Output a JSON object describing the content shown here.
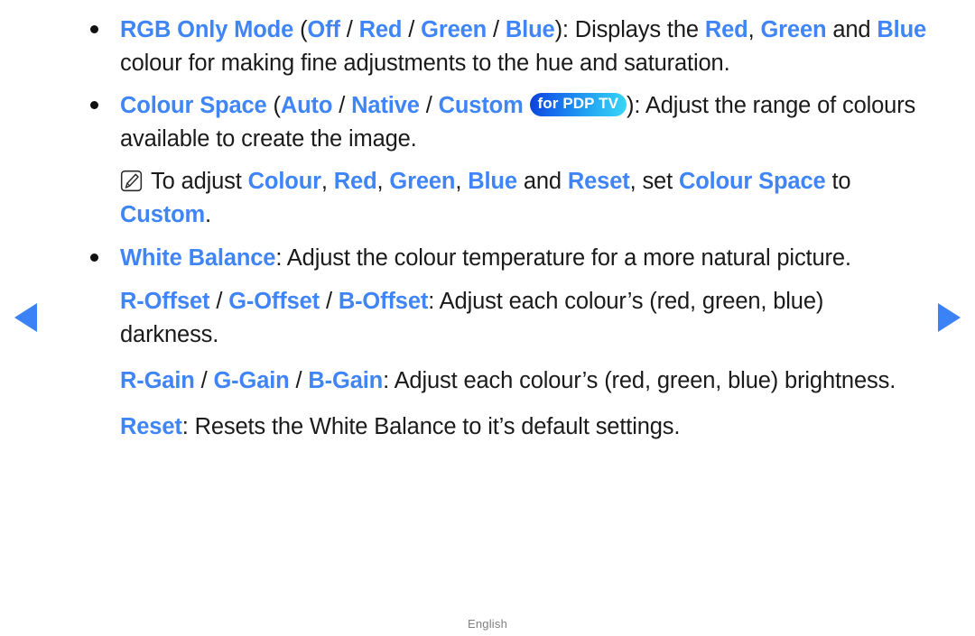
{
  "page": {
    "language_footer": "English",
    "accent_blue": "#3f85f7",
    "arrow_blue": "#3b82f6",
    "text_black": "#1a1a1a"
  },
  "nav": {
    "prev_icon": "triangle-left-icon",
    "next_icon": "triangle-right-icon"
  },
  "badge": {
    "for_pdp_tv": "for PDP TV",
    "gradient_from": "#0b3fd6",
    "gradient_to": "#3ad8f7"
  },
  "note_icon_name": "samsung-note-icon",
  "items": [
    {
      "type": "bullet",
      "runs": [
        {
          "t": "RGB Only Mode",
          "s": "kw"
        },
        {
          "t": " (",
          "s": "txt"
        },
        {
          "t": "Off",
          "s": "kw"
        },
        {
          "t": " / ",
          "s": "sep"
        },
        {
          "t": "Red",
          "s": "kw"
        },
        {
          "t": " / ",
          "s": "sep"
        },
        {
          "t": "Green",
          "s": "kw"
        },
        {
          "t": " / ",
          "s": "sep"
        },
        {
          "t": "Blue",
          "s": "kw"
        },
        {
          "t": "): Displays the ",
          "s": "txt"
        },
        {
          "t": "Red",
          "s": "kw"
        },
        {
          "t": ", ",
          "s": "txt"
        },
        {
          "t": "Green",
          "s": "kw"
        },
        {
          "t": " and ",
          "s": "txt"
        },
        {
          "t": "Blue",
          "s": "kw"
        },
        {
          "t": " colour for making fine adjustments to the hue and saturation.",
          "s": "txt"
        }
      ]
    },
    {
      "type": "bullet",
      "runs": [
        {
          "t": "Colour Space",
          "s": "kw"
        },
        {
          "t": " (",
          "s": "txt"
        },
        {
          "t": "Auto",
          "s": "kw"
        },
        {
          "t": " / ",
          "s": "sep"
        },
        {
          "t": "Native",
          "s": "kw"
        },
        {
          "t": " / ",
          "s": "sep"
        },
        {
          "t": "Custom",
          "s": "kw"
        },
        {
          "t": " ",
          "s": "txt"
        },
        {
          "t": "for PDP TV",
          "s": "pill"
        },
        {
          "t": "): Adjust the range of colours available to create the image.",
          "s": "txt"
        }
      ]
    },
    {
      "type": "note",
      "runs": [
        {
          "t": "To adjust ",
          "s": "txt"
        },
        {
          "t": "Colour",
          "s": "kw"
        },
        {
          "t": ", ",
          "s": "txt"
        },
        {
          "t": "Red",
          "s": "kw"
        },
        {
          "t": ", ",
          "s": "txt"
        },
        {
          "t": "Green",
          "s": "kw"
        },
        {
          "t": ", ",
          "s": "txt"
        },
        {
          "t": "Blue",
          "s": "kw"
        },
        {
          "t": " and ",
          "s": "txt"
        },
        {
          "t": "Reset",
          "s": "kw"
        },
        {
          "t": ", set ",
          "s": "txt"
        },
        {
          "t": "Colour Space",
          "s": "kw"
        },
        {
          "t": " to ",
          "s": "txt"
        },
        {
          "t": "Custom",
          "s": "kw"
        },
        {
          "t": ".",
          "s": "txt"
        }
      ]
    },
    {
      "type": "bullet",
      "runs": [
        {
          "t": "White Balance",
          "s": "kw"
        },
        {
          "t": ": Adjust the colour temperature for a more natural picture.",
          "s": "txt"
        }
      ]
    },
    {
      "type": "plain",
      "runs": [
        {
          "t": "R-Offset",
          "s": "kw"
        },
        {
          "t": " / ",
          "s": "sep"
        },
        {
          "t": "G-Offset",
          "s": "kw"
        },
        {
          "t": " / ",
          "s": "sep"
        },
        {
          "t": "B-Offset",
          "s": "kw"
        },
        {
          "t": ": Adjust each colour’s (red, green, blue) darkness.",
          "s": "txt"
        }
      ]
    },
    {
      "type": "plain",
      "runs": [
        {
          "t": "R-Gain",
          "s": "kw"
        },
        {
          "t": " / ",
          "s": "sep"
        },
        {
          "t": "G-Gain",
          "s": "kw"
        },
        {
          "t": " / ",
          "s": "sep"
        },
        {
          "t": "B-Gain",
          "s": "kw"
        },
        {
          "t": ": Adjust each colour’s (red, green, blue) brightness.",
          "s": "txt"
        }
      ]
    },
    {
      "type": "plain",
      "runs": [
        {
          "t": "Reset",
          "s": "kw"
        },
        {
          "t": ": Resets the White Balance to it’s default settings.",
          "s": "txt"
        }
      ]
    }
  ]
}
